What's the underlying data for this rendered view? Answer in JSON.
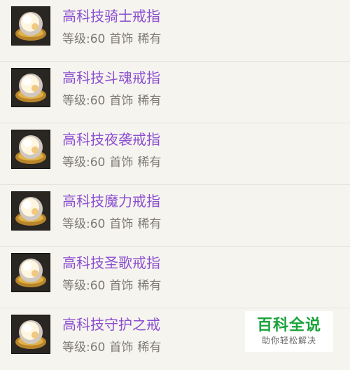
{
  "items": [
    {
      "name": "高科技骑士戒指",
      "level": "等级:60",
      "slot": "首饰",
      "rarity": "稀有",
      "icon": "ring-icon"
    },
    {
      "name": "高科技斗魂戒指",
      "level": "等级:60",
      "slot": "首饰",
      "rarity": "稀有",
      "icon": "ring-icon"
    },
    {
      "name": "高科技夜袭戒指",
      "level": "等级:60",
      "slot": "首饰",
      "rarity": "稀有",
      "icon": "ring-icon"
    },
    {
      "name": "高科技魔力戒指",
      "level": "等级:60",
      "slot": "首饰",
      "rarity": "稀有",
      "icon": "ring-icon"
    },
    {
      "name": "高科技圣歌戒指",
      "level": "等级:60",
      "slot": "首饰",
      "rarity": "稀有",
      "icon": "ring-icon"
    },
    {
      "name": "高科技守护之戒",
      "level": "等级:60",
      "slot": "首饰",
      "rarity": "稀有",
      "icon": "ring-icon"
    }
  ],
  "watermark": {
    "title": "百科全说",
    "subtitle": "助你轻松解决"
  },
  "colors": {
    "item_name": "#8b4fd0",
    "meta_text": "#7d7a76",
    "background": "#f6f4ef",
    "watermark_green": "#1aa33a"
  }
}
